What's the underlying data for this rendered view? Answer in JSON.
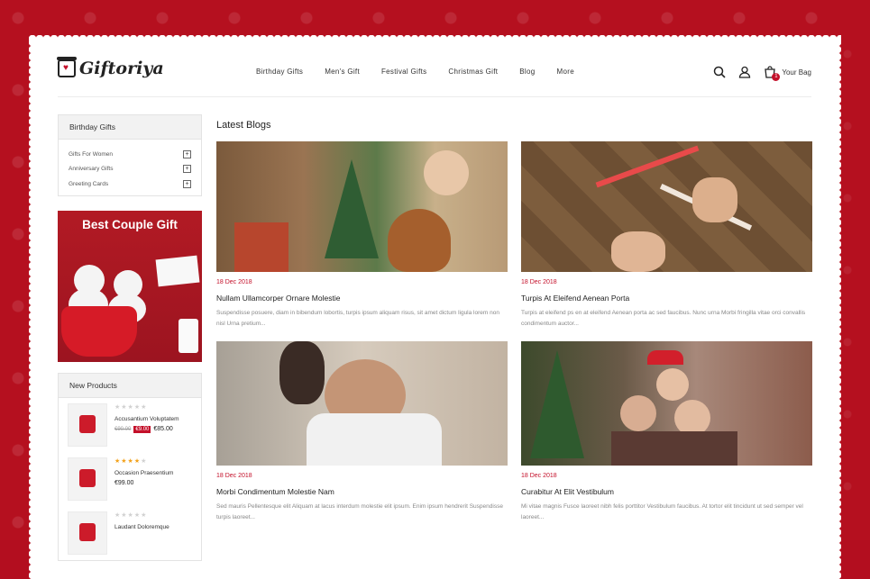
{
  "brand": {
    "name": "Giftoriya",
    "accent": "#c4102a"
  },
  "nav": [
    "Birthday Gifts",
    "Men's Gift",
    "Festival Gifts",
    "Christmas Gift",
    "Blog",
    "More"
  ],
  "header": {
    "bag_label": "Your Bag",
    "bag_count": "1",
    "icons": [
      "search-icon",
      "user-icon",
      "bag-icon"
    ]
  },
  "sidebar": {
    "category_title": "Birthday Gifts",
    "categories": [
      "Gifts For Women",
      "Anniversary Gifts",
      "Greeting Cards"
    ],
    "banner_title": "Best Couple Gift",
    "new_products_title": "New Products",
    "products": [
      {
        "name": "Accusantium Voluptatem",
        "old_price": "€90.00",
        "sale": "€9.00",
        "price": "€85.00",
        "rating": 0
      },
      {
        "name": "Occasion Praesentium",
        "price": "€99.00",
        "rating": 4
      },
      {
        "name": "Laudant Doloremque",
        "price": "",
        "rating": 0
      }
    ]
  },
  "main": {
    "title": "Latest Blogs",
    "posts": [
      {
        "date": "18 Dec 2018",
        "title": "Nullam Ullamcorper Ornare Molestie",
        "excerpt": "Suspendisse posuere, diam in bibendum lobortis, turpis ipsum aliquam risus, sit amet dictum ligula lorem non nisl Urna pretium..."
      },
      {
        "date": "18 Dec 2018",
        "title": "Turpis At Eleifend Aenean Porta",
        "excerpt": "Turpis at eleifend ps en at eleifend Aenean porta ac sed faucibus. Nunc urna Morbi fringilla vitae orci convallis condimentum auctor..."
      },
      {
        "date": "18 Dec 2018",
        "title": "Morbi Condimentum Molestie Nam",
        "excerpt": "Sed mauris Pellentesque elit Aliquam at lacus interdum molestie elit ipsum. Enim ipsum hendrerit Suspendisse turpis laoreet..."
      },
      {
        "date": "18 Dec 2018",
        "title": "Curabitur At Elit Vestibulum",
        "excerpt": "Mi vitae magnis Fusce laoreet nibh felis porttitor Vestibulum faucibus. At tortor elit tincidunt ut sed semper vel laoreet..."
      }
    ]
  }
}
